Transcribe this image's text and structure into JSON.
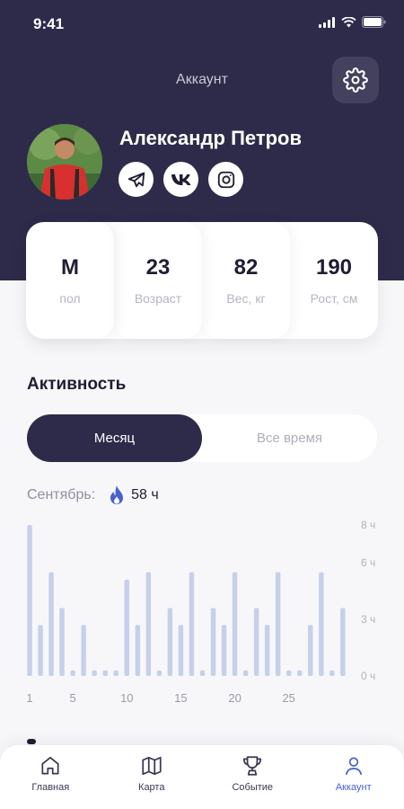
{
  "status_bar": {
    "time": "9:41"
  },
  "header": {
    "title": "Аккаунт"
  },
  "profile": {
    "name": "Александр Петров"
  },
  "socials": [
    "telegram-icon",
    "vk-icon",
    "instagram-icon"
  ],
  "stats": [
    {
      "value": "М",
      "label": "пол"
    },
    {
      "value": "23",
      "label": "Возраст"
    },
    {
      "value": "82",
      "label": "Вес, кг"
    },
    {
      "value": "190",
      "label": "Рост, см"
    }
  ],
  "activity": {
    "title": "Активность",
    "tabs": [
      {
        "label": "Месяц",
        "active": true
      },
      {
        "label": "Все время",
        "active": false
      }
    ],
    "month_label": "Сентябрь:",
    "total_hours": "58 ч"
  },
  "chart_data": {
    "type": "bar",
    "x": [
      1,
      2,
      3,
      4,
      5,
      6,
      7,
      8,
      9,
      10,
      11,
      12,
      13,
      14,
      15,
      16,
      17,
      18,
      19,
      20,
      21,
      22,
      23,
      24,
      25,
      26,
      27,
      28,
      29,
      30
    ],
    "values": [
      8.0,
      2.7,
      5.5,
      3.6,
      0.3,
      2.7,
      0.3,
      0.3,
      0.3,
      5.1,
      2.7,
      5.5,
      0.3,
      3.6,
      2.7,
      5.5,
      0.3,
      3.6,
      2.7,
      5.5,
      0.3,
      3.6,
      2.7,
      5.5,
      0.3,
      0.3,
      2.7,
      5.5,
      0.3,
      3.6
    ],
    "x_ticks": [
      "1",
      "5",
      "10",
      "15",
      "20",
      "25"
    ],
    "x_tick_values": [
      1,
      5,
      10,
      15,
      20,
      25
    ],
    "y_ticks": [
      "8 ч",
      "6 ч",
      "3 ч",
      "0 ч"
    ],
    "y_tick_values": [
      8,
      6,
      3,
      0
    ],
    "ylim": [
      0,
      8
    ],
    "bar_color": "#c7d0ea",
    "grid": false
  },
  "tabbar": [
    {
      "label": "Главная",
      "icon": "home-icon",
      "active": false
    },
    {
      "label": "Карта",
      "icon": "map-icon",
      "active": false
    },
    {
      "label": "Событие",
      "icon": "trophy-icon",
      "active": false
    },
    {
      "label": "Аккаунт",
      "icon": "user-icon",
      "active": true
    }
  ],
  "colors": {
    "primary": "#2e2b4a",
    "accent": "#4a60cf",
    "bar": "#c7d0ea",
    "background": "#f7f7f9"
  }
}
